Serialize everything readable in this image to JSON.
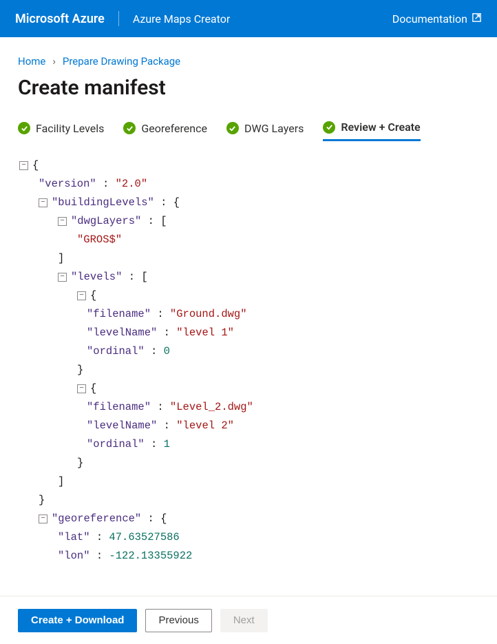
{
  "topbar": {
    "brand": "Microsoft Azure",
    "product": "Azure Maps Creator",
    "documentation": "Documentation"
  },
  "breadcrumb": {
    "home": "Home",
    "prepare": "Prepare Drawing Package"
  },
  "page": {
    "title": "Create manifest"
  },
  "steps": {
    "s1": "Facility Levels",
    "s2": "Georeference",
    "s3": "DWG Layers",
    "s4": "Review + Create"
  },
  "manifest": {
    "version_key": "\"version\"",
    "version_val": "\"2.0\"",
    "buildingLevels_key": "\"buildingLevels\"",
    "dwgLayers_key": "\"dwgLayers\"",
    "dwgLayers_v0": "\"GROS$\"",
    "levels_key": "\"levels\"",
    "l0_filename_key": "\"filename\"",
    "l0_filename_val": "\"Ground.dwg\"",
    "l0_levelName_key": "\"levelName\"",
    "l0_levelName_val": "\"level 1\"",
    "l0_ordinal_key": "\"ordinal\"",
    "l0_ordinal_val": "0",
    "l1_filename_key": "\"filename\"",
    "l1_filename_val": "\"Level_2.dwg\"",
    "l1_levelName_key": "\"levelName\"",
    "l1_levelName_val": "\"level 2\"",
    "l1_ordinal_key": "\"ordinal\"",
    "l1_ordinal_val": "1",
    "georef_key": "\"georeference\"",
    "lat_key": "\"lat\"",
    "lat_val": "47.63527586",
    "lon_key": "\"lon\"",
    "lon_val": "-122.13355922"
  },
  "footer": {
    "create": "Create + Download",
    "previous": "Previous",
    "next": "Next"
  }
}
